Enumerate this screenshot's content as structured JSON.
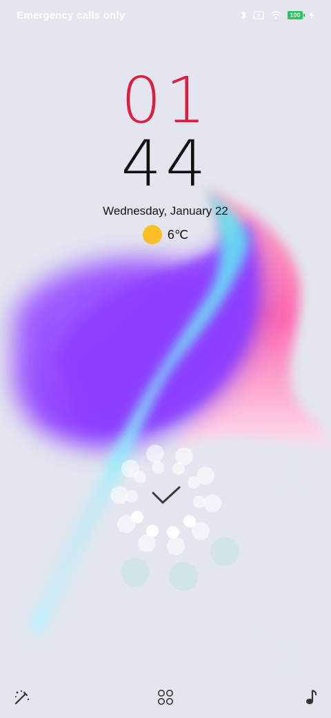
{
  "status_bar": {
    "carrier_text": "Emergency calls only",
    "battery_level": "100",
    "icons": [
      "bluetooth-icon",
      "no-sim-icon",
      "wifi-icon",
      "battery-icon",
      "charging-icon"
    ]
  },
  "clock": {
    "hour": "01",
    "minute": "44"
  },
  "date": "Wednesday, January 22",
  "weather": {
    "icon": "sunny-icon",
    "temperature": "6℃"
  },
  "unlock": {
    "icon": "checkmark-icon"
  },
  "bottom_shortcuts": {
    "left": "magic-wand-icon",
    "center": "apps-grid-icon",
    "right": "music-note-icon"
  },
  "colors": {
    "hour": "#e11d3f",
    "minute": "#111111",
    "background": "#e3e6ef",
    "accent_purple": "#9b4dff",
    "accent_cyan": "#39e0e8",
    "accent_pink": "#ff4fa0"
  }
}
